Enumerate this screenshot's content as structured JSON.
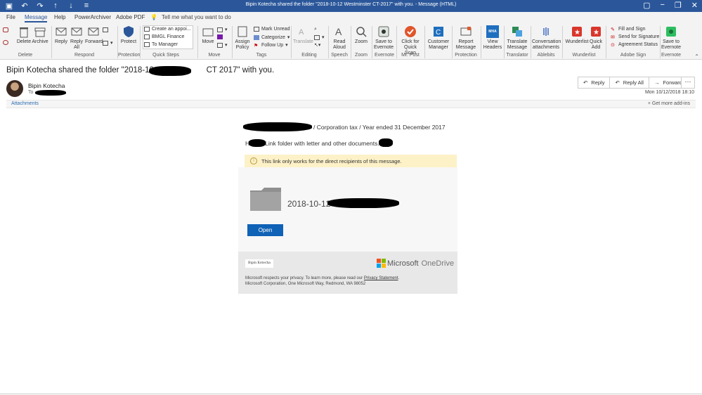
{
  "window": {
    "title": "Bipin Kotecha shared the folder \"2018-10-12 Westminster CT-2017\" with you.  -  Message (HTML)"
  },
  "tabs": [
    "File",
    "Message",
    "Help",
    "PowerArchiver",
    "Adobe PDF"
  ],
  "tellme": "Tell me what you want to do",
  "ribbon": {
    "delete": "Delete",
    "archive": "Archive",
    "reply": "Reply",
    "reply_all": "Reply All",
    "forward": "Forward",
    "protect": "Protect",
    "quick_steps": [
      "Create an appoi...",
      "BMGL Finance",
      "To Manager"
    ],
    "move": "Move",
    "assign_policy": "Assign Policy",
    "mark_unread": "Mark Unread",
    "categorize": "Categorize",
    "follow_up": "Follow Up",
    "translate": "Translate",
    "read_aloud": "Read Aloud",
    "zoom": "Zoom",
    "save_evernote": "Save to Evernote",
    "click_quick_scan": "Click for Quick Scan",
    "customer_manager": "Customer Manager",
    "report_message": "Report Message",
    "view_headers": "View Headers",
    "translate_message": "Translate Message",
    "conversation_attachments": "Conversation attachments",
    "wunderlist": "Wunderlist",
    "quick_add": "Quick Add",
    "fill_and_sign": "Fill and Sign",
    "send_for_signature": "Send for Signature",
    "agreement_status": "Agreement Status",
    "save_to_evernote2": "Save to Evernote",
    "groups": [
      "Delete",
      "Respond",
      "Protection",
      "Quick Steps",
      "Move",
      "Tags",
      "Editing",
      "Speech",
      "Zoom",
      "Evernote",
      "Mr. Post",
      "Protection",
      "MHA",
      "Translator",
      "Ablebits",
      "Wunderlist",
      "Adobe Sign",
      "Evernote"
    ],
    "mha_icon_text": "MHA"
  },
  "message": {
    "subject_start": "Bipin Kotecha shared the folder \"2018-10-12",
    "subject_end": "CT 2017\" with you.",
    "sender": "Bipin Kotecha",
    "to_label": "To",
    "date": "Mon 10/12/2018 18:10",
    "reply": "Reply",
    "reply_all": "Reply All",
    "forward": "Forward",
    "more": "···",
    "attachments": "Attachments",
    "get_addins": "Get more add-ins"
  },
  "card": {
    "path": "/ Corporation tax / Year ended 31 December 2017",
    "message_prefix": "H",
    "message": "Link folder with letter and other documents.",
    "notice": "This link only works for the direct recipients of this message.",
    "folder_name": "2018-10-12",
    "open_button": "Open",
    "signature": "Bipin Kotecha",
    "brand": "Microsoft",
    "product": "OneDrive",
    "privacy_prefix": "Microsoft respects your privacy. To learn more, please read our ",
    "privacy_link": "Privacy Statement",
    "privacy_suffix": ".",
    "address": "Microsoft Corporation, One Microsoft Way, Redmond, WA 98052"
  },
  "colors": {
    "titlebar": "#2b579a",
    "open_button": "#0f62b6",
    "notice_bg": "#fdf1c8"
  }
}
